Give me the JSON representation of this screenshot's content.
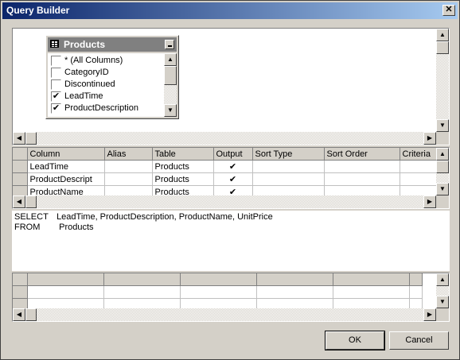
{
  "window": {
    "title": "Query Builder",
    "close_glyph": "✕"
  },
  "table_box": {
    "name": "Products",
    "columns": [
      {
        "label": "* (All Columns)",
        "checked": false
      },
      {
        "label": "CategoryID",
        "checked": false
      },
      {
        "label": "Discontinued",
        "checked": false
      },
      {
        "label": "LeadTime",
        "checked": true
      },
      {
        "label": "ProductDescription",
        "checked": true
      }
    ]
  },
  "grid": {
    "headers": [
      "Column",
      "Alias",
      "Table",
      "Output",
      "Sort Type",
      "Sort Order",
      "Criteria"
    ],
    "rows": [
      {
        "column": "LeadTime",
        "alias": "",
        "table": "Products",
        "output": "✔"
      },
      {
        "column": "ProductDescript",
        "alias": "",
        "table": "Products",
        "output": "✔"
      },
      {
        "column": "ProductName",
        "alias": "",
        "table": "Products",
        "output": "✔"
      }
    ]
  },
  "sql": {
    "select_kw": "SELECT",
    "select_text": "LeadTime, ProductDescription, ProductName, UnitPrice",
    "from_kw": "FROM",
    "from_text": "Products"
  },
  "buttons": {
    "ok": "OK",
    "cancel": "Cancel"
  },
  "scroll_arrows": {
    "up": "▲",
    "down": "▼",
    "left": "◀",
    "right": "▶"
  },
  "check_glyph": "✔"
}
